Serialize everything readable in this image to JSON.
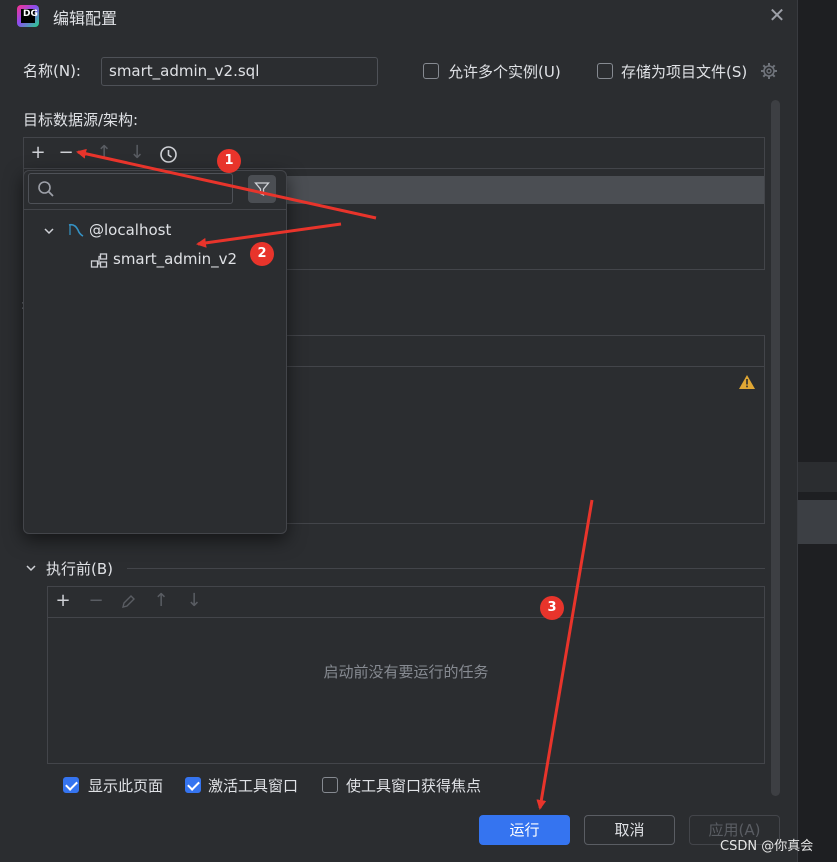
{
  "dialog": {
    "title": "编辑配置"
  },
  "name_row": {
    "label": "名称(N):",
    "value": "smart_admin_v2.sql",
    "allow_multiple": {
      "label": "允许多个实例(U)",
      "checked": false
    },
    "store_as_project_file": {
      "label": "存储为项目文件(S)",
      "checked": false
    }
  },
  "target_section": {
    "label": "目标数据源/架构:"
  },
  "popup": {
    "search_value": "",
    "tree": {
      "root": "@localhost",
      "child": "smart_admin_v2"
    }
  },
  "before_launch": {
    "header": "执行前(B)",
    "empty_text": "启动前没有要运行的任务"
  },
  "options": {
    "show_page": {
      "label": "显示此页面",
      "checked": true
    },
    "activate_tool_window": {
      "label": "激活工具窗口",
      "checked": true
    },
    "focus_tool_window": {
      "label": "使工具窗口获得焦点",
      "checked": false
    }
  },
  "buttons": {
    "run": "运行",
    "cancel": "取消",
    "apply": "应用(A)"
  },
  "markers": [
    "1",
    "2",
    "3"
  ],
  "watermark": "CSDN @你真会",
  "colors": {
    "accent": "#3574f0",
    "annotation": "#e8342b",
    "warning": "#e0a734"
  }
}
